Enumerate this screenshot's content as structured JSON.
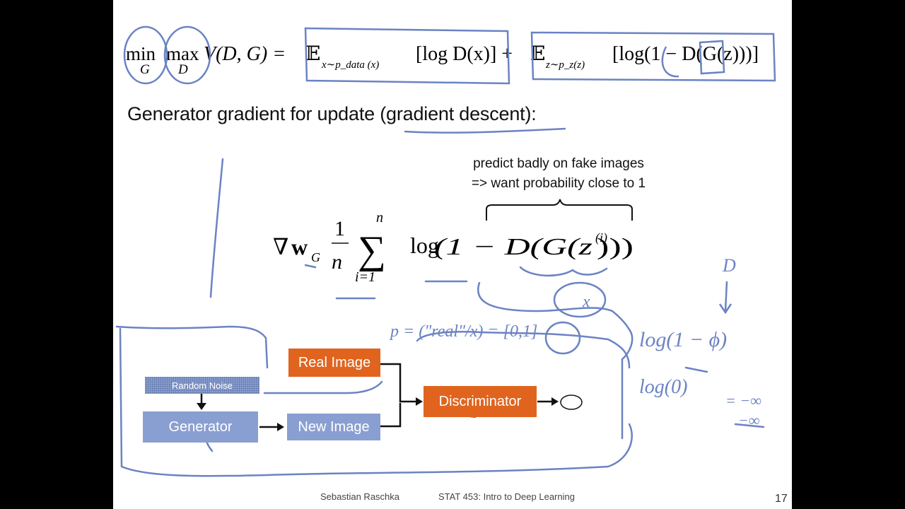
{
  "slide": {
    "formula_top": {
      "min_op": "min",
      "min_sub": "G",
      "max_op": "max",
      "max_sub": "D",
      "value_fn": "V(D, G) =",
      "term1": "𝔼",
      "term1_sub": "x∼p_data (x)",
      "term1_body": "[log D(x)] +",
      "term2": "𝔼",
      "term2_sub": "z∼p_z(z)",
      "term2_body": "[log(1 − D(G(z)))]"
    },
    "heading": "Generator gradient for update (gradient descent):",
    "annotation": {
      "line1": "predict badly on fake images",
      "line2": "=> want probability close to 1"
    },
    "formula_gradient": {
      "nabla": "∇",
      "w": "w",
      "w_sub": "G",
      "frac_num": "1",
      "frac_den": "n",
      "sum": "∑",
      "sum_top": "n",
      "sum_bottom": "i=1",
      "log": "log",
      "body": "(1 − D(G(z",
      "sup": "(i)",
      "close": ")))"
    },
    "diagram": {
      "random_noise": "Random Noise",
      "generator": "Generator",
      "new_image": "New Image",
      "real_image": "Real Image",
      "discriminator": "Discriminator"
    },
    "handwriting": {
      "x_sup": "x",
      "p_label": "p = (\"real\"/x) = [0,1]",
      "d_label": "D",
      "log1": "log(1 − ϕ)",
      "log2": "log(0)",
      "neg_inf1": "= −∞",
      "neg_inf2": "−∞"
    },
    "footer": {
      "author": "Sebastian Raschka",
      "course": "STAT 453: Intro to Deep Learning",
      "page": "17"
    },
    "colors": {
      "ink": "#6b83c4",
      "generator_box": "#8a9fd1",
      "discriminator_box": "#e0641e"
    }
  }
}
